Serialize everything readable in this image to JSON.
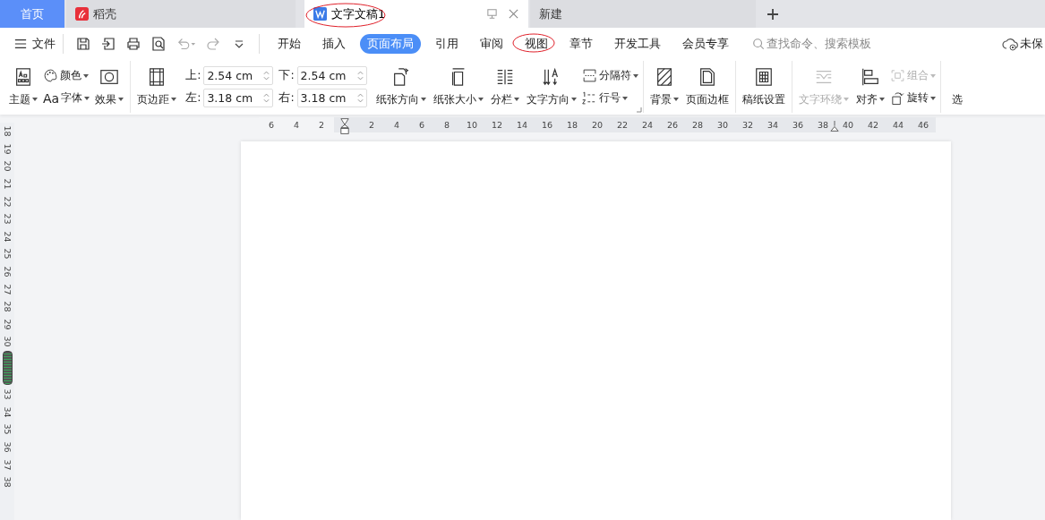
{
  "tabs": [
    {
      "kind": "home",
      "label": "首页",
      "selected": false
    },
    {
      "kind": "daoke",
      "label": "稻壳",
      "selected": false
    },
    {
      "kind": "doc",
      "label": "文字文稿1",
      "selected": true
    },
    {
      "kind": "new",
      "label": "新建",
      "selected": false
    }
  ],
  "menu": {
    "file_label": "文件",
    "ribbon_tabs": [
      {
        "label": "开始",
        "selected": false
      },
      {
        "label": "插入",
        "selected": false
      },
      {
        "label": "页面布局",
        "selected": true
      },
      {
        "label": "引用",
        "selected": false
      },
      {
        "label": "审阅",
        "selected": false
      },
      {
        "label": "视图",
        "selected": false
      },
      {
        "label": "章节",
        "selected": false
      },
      {
        "label": "开发工具",
        "selected": false
      },
      {
        "label": "会员专享",
        "selected": false
      }
    ],
    "search": {
      "placeholder": "查找命令、搜索模板"
    },
    "save_status": "未保"
  },
  "ribbon": {
    "groups": [
      {
        "items": [
          {
            "kind": "big",
            "label": "主题",
            "dropdown": true,
            "disabled": false
          },
          {
            "kind": "stack",
            "items": [
              {
                "label": "颜色",
                "dropdown": true,
                "disabled": false
              },
              {
                "label": "字体",
                "glyph": "Aa",
                "dropdown": true,
                "disabled": false
              }
            ]
          },
          {
            "kind": "big",
            "label": "效果",
            "dropdown": true,
            "disabled": false
          }
        ]
      },
      {
        "launcher": true,
        "items": [
          {
            "kind": "big",
            "label": "页边距",
            "dropdown": true,
            "disabled": false
          },
          {
            "kind": "margins",
            "fields": [
              {
                "label": "上:",
                "value": "2.54 cm"
              },
              {
                "label": "下:",
                "value": "2.54 cm"
              },
              {
                "label": "左:",
                "value": "3.18 cm"
              },
              {
                "label": "右:",
                "value": "3.18 cm"
              }
            ]
          },
          {
            "kind": "big",
            "label": "纸张方向",
            "dropdown": true,
            "disabled": false
          },
          {
            "kind": "big",
            "label": "纸张大小",
            "dropdown": true,
            "disabled": false
          },
          {
            "kind": "big",
            "label": "分栏",
            "dropdown": true,
            "disabled": false
          },
          {
            "kind": "big",
            "label": "文字方向",
            "dropdown": true,
            "disabled": false
          },
          {
            "kind": "stack",
            "items": [
              {
                "label": "分隔符",
                "dropdown": true,
                "disabled": false
              },
              {
                "label": "行号",
                "dropdown": true,
                "disabled": false
              }
            ]
          }
        ]
      },
      {
        "items": [
          {
            "kind": "big",
            "label": "背景",
            "dropdown": true,
            "disabled": false
          },
          {
            "kind": "big",
            "label": "页面边框",
            "dropdown": false,
            "disabled": false
          }
        ]
      },
      {
        "items": [
          {
            "kind": "big",
            "label": "稿纸设置",
            "dropdown": false,
            "disabled": false
          }
        ]
      },
      {
        "items": [
          {
            "kind": "big",
            "label": "文字环绕",
            "dropdown": true,
            "disabled": true
          },
          {
            "kind": "big",
            "label": "对齐",
            "dropdown": true,
            "disabled": false
          },
          {
            "kind": "stack",
            "items": [
              {
                "label": "组合",
                "dropdown": true,
                "disabled": true
              },
              {
                "label": "旋转",
                "dropdown": true,
                "disabled": false
              }
            ]
          }
        ]
      },
      {
        "items": [
          {
            "kind": "cut",
            "label": "选"
          }
        ]
      }
    ]
  },
  "ruler": {
    "left_numbers": [
      "6",
      "4",
      "2"
    ],
    "right_numbers": [
      "2",
      "4",
      "6",
      "8",
      "10",
      "12",
      "14",
      "16",
      "18",
      "20",
      "22",
      "24",
      "26",
      "28",
      "30",
      "32",
      "34",
      "36",
      "38",
      "40",
      "42",
      "44",
      "46"
    ],
    "vertical_numbers_above": [
      "18",
      "19",
      "20",
      "21",
      "22",
      "23",
      "24",
      "25",
      "26",
      "27",
      "28",
      "29",
      "30"
    ],
    "vertical_numbers_below": [
      "33",
      "34",
      "35",
      "36",
      "37",
      "38"
    ]
  }
}
